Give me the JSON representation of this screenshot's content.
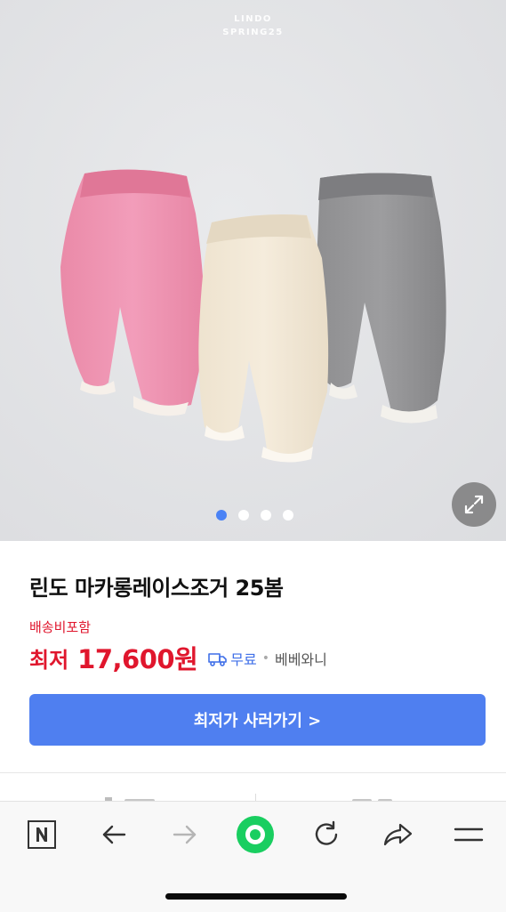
{
  "gallery": {
    "watermark_line1": "LINDO",
    "watermark_line2": "SPRING25",
    "slide_count": 4,
    "active_slide": 1,
    "expand_icon": "expand-arrows-icon"
  },
  "product": {
    "title": "린도 마카롱레이스조거 25봄",
    "shipping_note": "배송비포함",
    "price_label": "최저",
    "price": "17,600원",
    "delivery_icon": "truck-icon",
    "delivery_text": "무료",
    "separator": "•",
    "seller": "베베와니",
    "buy_button_label": "최저가 사러가기 >"
  },
  "browser_bar": {
    "items": [
      "naver-home-icon",
      "back-arrow-icon",
      "forward-arrow-icon",
      "green-dot-icon",
      "refresh-icon",
      "share-icon",
      "menu-icon"
    ]
  },
  "colors": {
    "price_red": "#e0162d",
    "accent_blue": "#4f7ff0",
    "naver_green": "#19ce60"
  }
}
